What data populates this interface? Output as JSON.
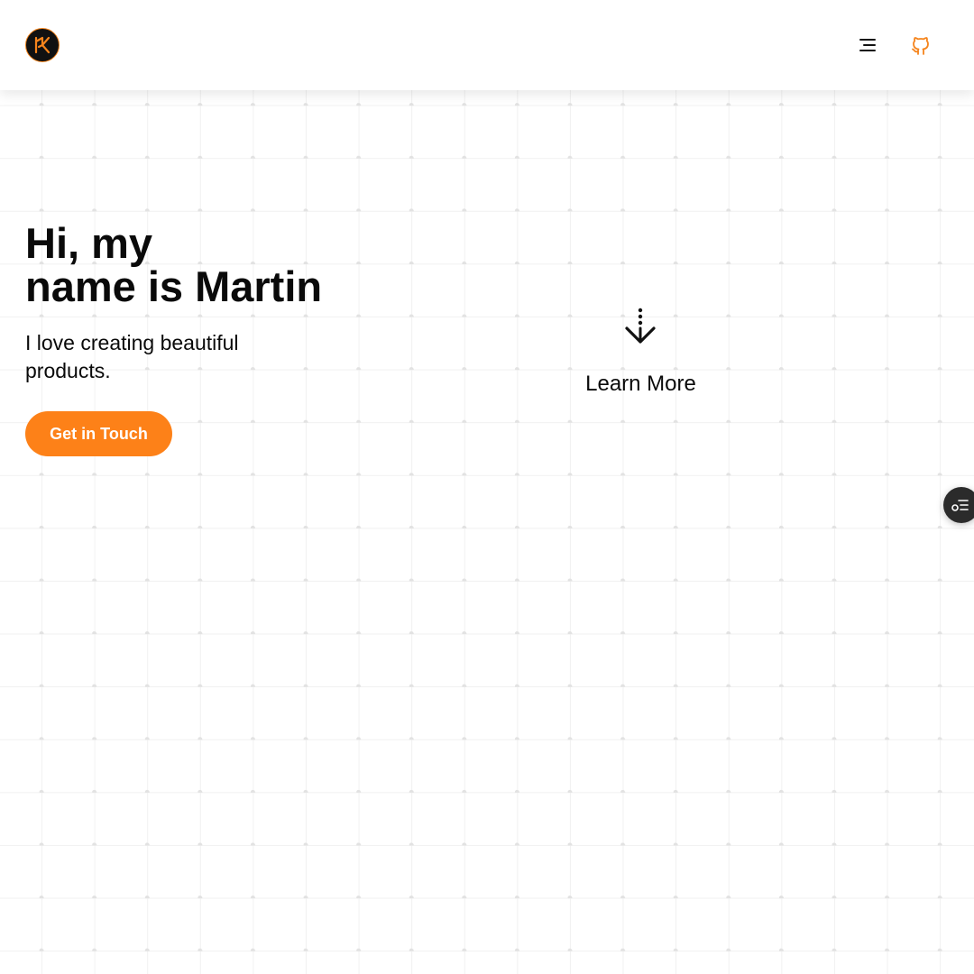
{
  "header": {
    "logo_icon": "mk-monogram-logo",
    "menu_icon": "hamburger-menu-icon",
    "github_icon": "github-icon"
  },
  "hero": {
    "title_line1": "Hi, my",
    "title_line2": "name is Martin",
    "subtitle": "I love creating beautiful products.",
    "cta_label": "Get in Touch"
  },
  "learn_more": {
    "icon": "dotted-arrow-down-icon",
    "label": "Learn More"
  },
  "side_panel": {
    "icon": "settings-list-icon"
  },
  "colors": {
    "accent": "#fd8118",
    "text": "#0a0a0a",
    "background": "#ffffff",
    "side_button": "#2b2b2b"
  }
}
